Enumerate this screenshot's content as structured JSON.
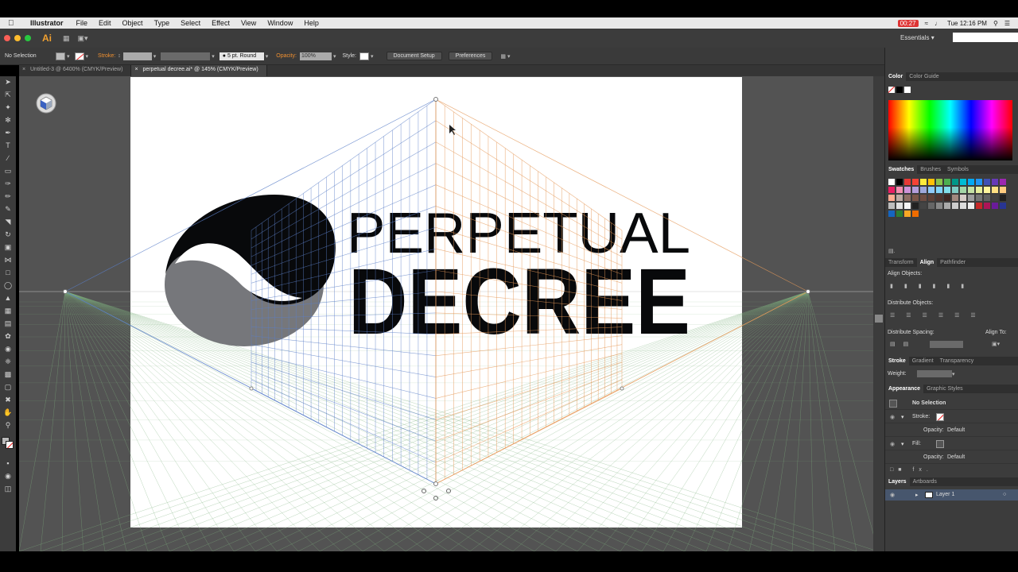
{
  "menubar": {
    "app": "Illustrator",
    "items": [
      "File",
      "Edit",
      "Object",
      "Type",
      "Select",
      "Effect",
      "View",
      "Window",
      "Help"
    ],
    "rec_time": "00:27",
    "clock": "Tue 12:16 PM"
  },
  "appbar": {
    "logo": "Ai",
    "workspace": "Essentials"
  },
  "control": {
    "selection": "No Selection",
    "stroke_label": "Stroke:",
    "brush": "5 pt. Round",
    "opacity_label": "Opacity:",
    "opacity_value": "100%",
    "style_label": "Style:",
    "doc_setup": "Document Setup",
    "preferences": "Preferences"
  },
  "tabs": [
    {
      "label": "Untitled-3 @ 6400% (CMYK/Preview)",
      "active": false
    },
    {
      "label": "perpetual decree.ai* @ 145% (CMYK/Preview)",
      "active": true
    }
  ],
  "artwork": {
    "line1": "PERPETUAL",
    "line2": "DECREE"
  },
  "panels": {
    "color_tabs": [
      "Color",
      "Color Guide"
    ],
    "swatch_tabs": [
      "Swatches",
      "Brushes",
      "Symbols"
    ],
    "align_tabs": [
      "Transform",
      "Align",
      "Pathfinder"
    ],
    "align_objects": "Align Objects:",
    "distribute_objects": "Distribute Objects:",
    "distribute_spacing": "Distribute Spacing:",
    "align_to": "Align To:",
    "stroke_tabs": [
      "Stroke",
      "Gradient",
      "Transparency"
    ],
    "weight_label": "Weight:",
    "appearance_tabs": [
      "Appearance",
      "Graphic Styles"
    ],
    "appearance_rows": {
      "title": "No Selection",
      "stroke": "Stroke:",
      "opacity1": "Opacity:",
      "opacity1_val": "Default",
      "fill": "Fill:",
      "opacity2": "Opacity:",
      "opacity2_val": "Default"
    },
    "layers_tabs": [
      "Layers",
      "Artboards"
    ],
    "layer_name": "Layer 1"
  },
  "colors": {
    "accent_orange": "#f09030",
    "grid_blue": "#5b7fc8",
    "grid_orange": "#e59a5a",
    "grid_green": "#7fb37f"
  }
}
